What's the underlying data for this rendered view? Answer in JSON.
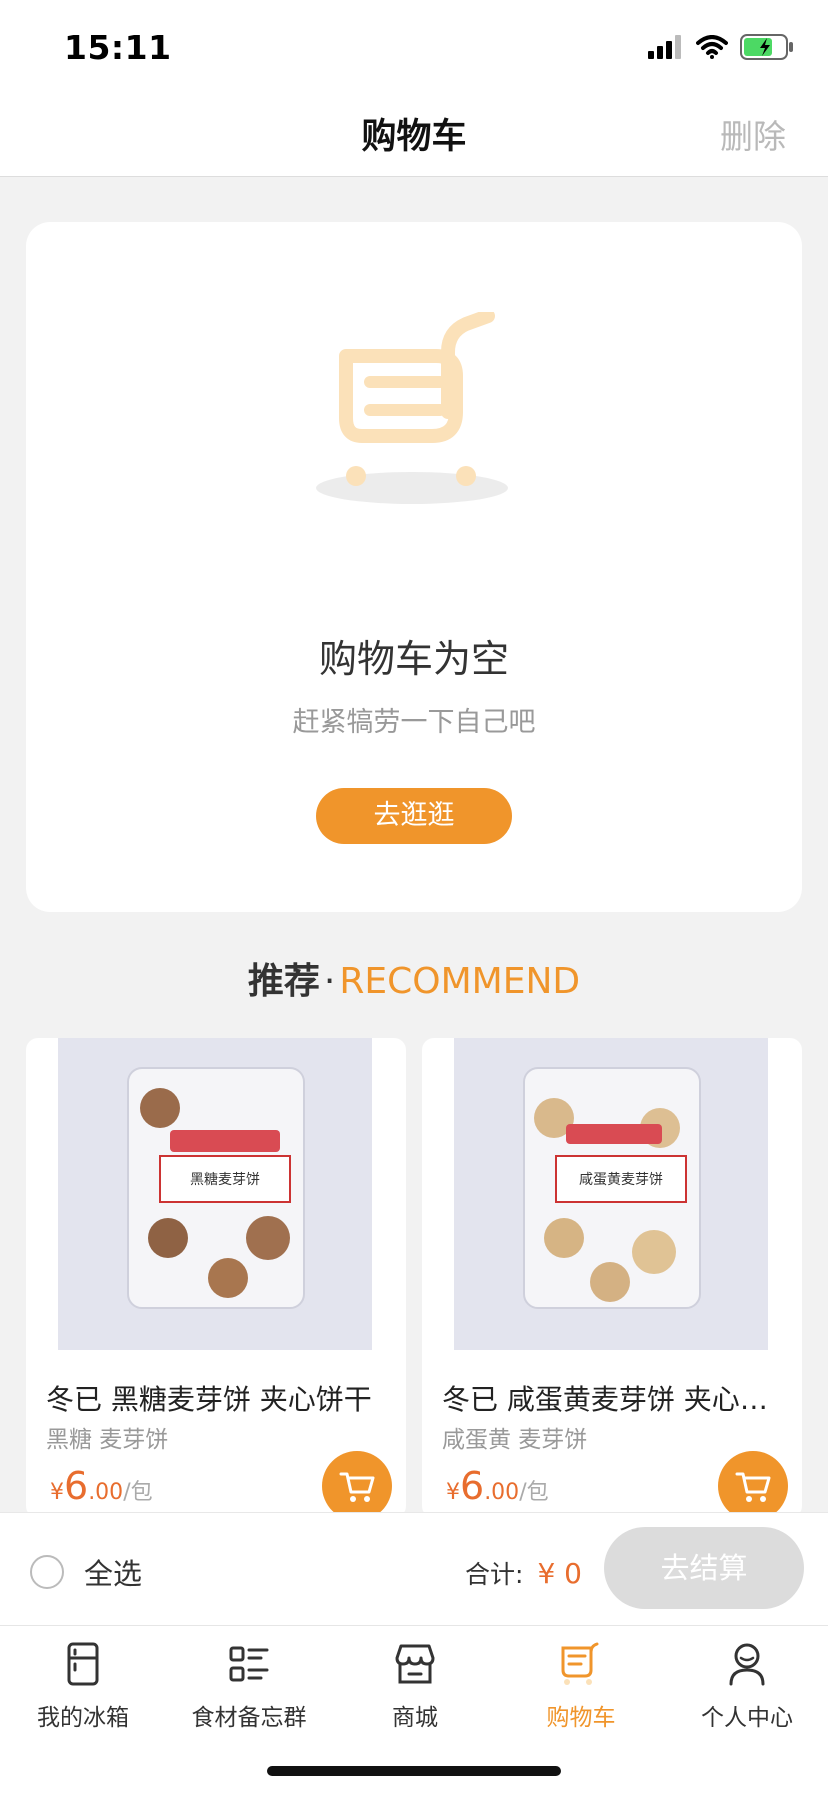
{
  "status_bar": {
    "time": "15:11"
  },
  "nav": {
    "title": "购物车",
    "delete_label": "删除"
  },
  "empty_state": {
    "title": "购物车为空",
    "subtitle": "赶紧犒劳一下自己吧",
    "button_label": "去逛逛",
    "illustration_icon": "shopping-cart-icon"
  },
  "recommend": {
    "title_cn": "推荐",
    "separator": "·",
    "title_en": "RECOMMEND"
  },
  "products": [
    {
      "name": "冬已  黑糖麦芽饼  夹心饼干",
      "tags": "黑糖 麦芽饼",
      "currency": "¥",
      "price_int": "6",
      "price_dec": ".00",
      "unit": "/包",
      "package_text": "黑糖麦芽饼"
    },
    {
      "name": "冬已  咸蛋黄麦芽饼  夹心饼干",
      "tags": "咸蛋黄 麦芽饼",
      "currency": "¥",
      "price_int": "6",
      "price_dec": ".00",
      "unit": "/包",
      "package_text": "咸蛋黄麦芽饼"
    }
  ],
  "bottom_bar": {
    "select_all_label": "全选",
    "total_label": "合计:",
    "total_value": "¥ 0",
    "checkout_label": "去结算"
  },
  "tabs": [
    {
      "label": "我的冰箱",
      "icon": "fridge-icon",
      "active": false
    },
    {
      "label": "食材备忘群",
      "icon": "list-icon",
      "active": false
    },
    {
      "label": "商城",
      "icon": "store-icon",
      "active": false
    },
    {
      "label": "购物车",
      "icon": "cart-icon",
      "active": true
    },
    {
      "label": "个人中心",
      "icon": "user-icon",
      "active": false
    }
  ],
  "colors": {
    "accent": "#f0952b",
    "price": "#e86d2e",
    "illustration": "#fbe1b9",
    "disabled_button": "#dcdcdc"
  }
}
